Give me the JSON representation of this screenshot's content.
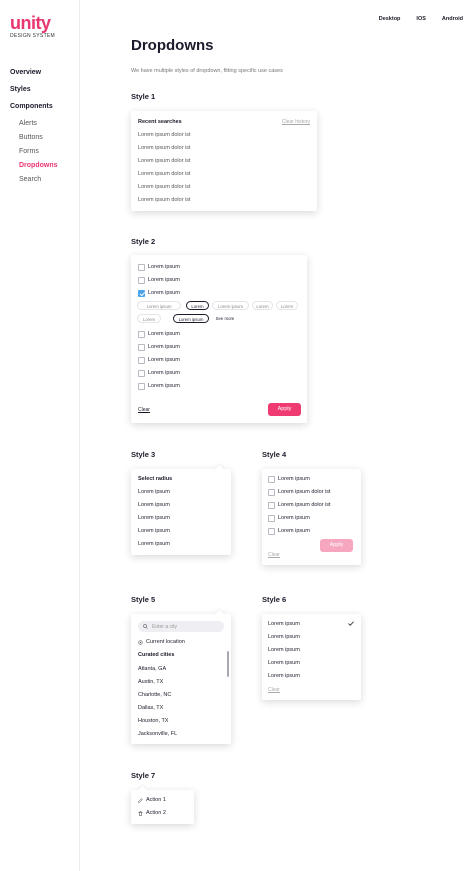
{
  "brand": {
    "name": "unity",
    "subtitle": "DESIGN SYSTEM"
  },
  "sidebar": {
    "overview": "Overview",
    "styles": "Styles",
    "components": "Components",
    "sub": [
      "Alerts",
      "Buttons",
      "Forms",
      "Dropdowns",
      "Search"
    ],
    "active": "Dropdowns"
  },
  "topnav": [
    "Desktop",
    "IOS",
    "Android"
  ],
  "page": {
    "title": "Dropdowns",
    "description": "We have multiple styles of dropdown, fitting specific use cases"
  },
  "colors": {
    "accent": "#e8366f",
    "button": "#ef3a72",
    "checkbox": "#4aa4e9"
  },
  "style1": {
    "title": "Style 1",
    "header": "Recent searches",
    "clear": "Clear history",
    "items": [
      "Lorem ipsum dolor ist",
      "Lorem ipsum dolor ist",
      "Lorem ipsum dolor ist",
      "Lorem ipsum dolor ist",
      "Lorem ipsum dolor ist",
      "Lorem ipsum dolor ist"
    ]
  },
  "style2": {
    "title": "Style 2",
    "top_items": [
      "Lorem ipsum",
      "Lorem ipsum",
      "Lorem ipsum"
    ],
    "chips_row1": [
      "Lorem ipsum",
      "Lorem",
      "Lorem ipsum",
      "Lorem",
      "Lorem"
    ],
    "chips_row2": [
      "Lorem",
      "Lorem ipsum",
      "See more"
    ],
    "bottom_items": [
      "Lorem ipsum",
      "Lorem ipsum",
      "Lorem ipsum",
      "Lorem ipsum",
      "Lorem ipsum"
    ],
    "clear": "Clear",
    "apply": "Apply"
  },
  "style3": {
    "title": "Style 3",
    "header": "Select radius",
    "items": [
      "Lorem ipsum",
      "Lorem ipsum",
      "Lorem ipsum",
      "Lorem ipsum",
      "Lorem ipsum"
    ]
  },
  "style4": {
    "title": "Style 4",
    "items": [
      "Lorem ipsum",
      "Lorem ipsum dolor ist",
      "Lorem ipsum dolor ist",
      "Lorem ipsum",
      "Lorem ipsum"
    ],
    "clear": "Clear",
    "apply": "Apply"
  },
  "style5": {
    "title": "Style 5",
    "search_placeholder": "Enter a city",
    "current_location": "Current location",
    "curated_header": "Curated cities",
    "cities": [
      "Atlanta, GA",
      "Austin, TX",
      "Charlotte, NC",
      "Dallas, TX",
      "Houston, TX",
      "Jacksonville, FL"
    ]
  },
  "style6": {
    "title": "Style 6",
    "items": [
      "Lorem ipsum",
      "Lorem ipsum",
      "Lorem ipsum",
      "Lorem ipsum",
      "Lorem ipsum"
    ],
    "clear": "Clear"
  },
  "style7": {
    "title": "Style 7",
    "actions": [
      "Action 1",
      "Action 2"
    ]
  },
  "icons": {
    "check": "check-icon",
    "search": "search-icon",
    "location": "location-icon",
    "edit": "pencil-icon",
    "delete": "trash-icon"
  }
}
